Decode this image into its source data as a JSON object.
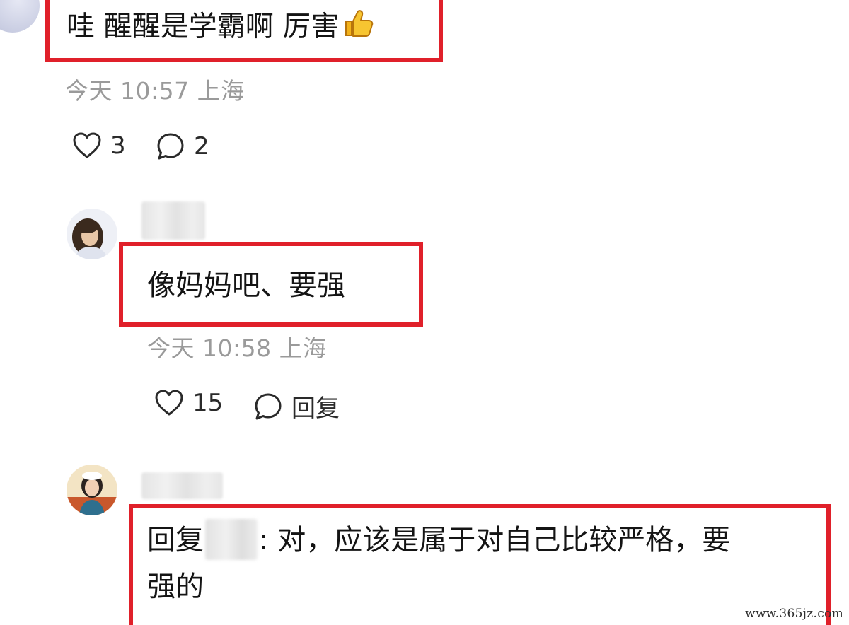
{
  "comments": [
    {
      "text": "哇 醒醒是学霸啊 厉害",
      "emoji": "thumbs-up-icon",
      "time": "今天 10:57 上海",
      "likes": "3",
      "replies": "2"
    },
    {
      "text": "像妈妈吧、要强",
      "time": "今天 10:58 上海",
      "likes": "15",
      "reply_label": "回复"
    },
    {
      "reply_prefix": "回复",
      "text_line1": ": 对，应该是属于对自己比较严格，要",
      "text_line2": "强的"
    }
  ],
  "watermark": "www.365jz.com",
  "colors": {
    "highlight_border": "#e0202a",
    "meta_text": "#9a9a9a",
    "body_text": "#141414"
  }
}
